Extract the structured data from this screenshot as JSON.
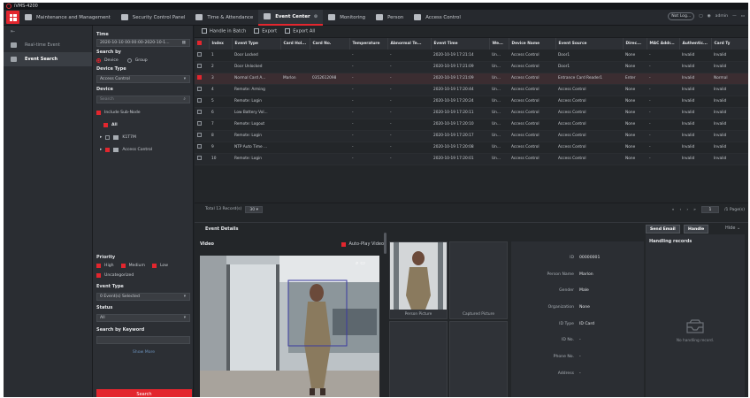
{
  "app": {
    "title": "iVMS-4200"
  },
  "nav": {
    "tabs": [
      {
        "label": "Maintenance and Management"
      },
      {
        "label": "Security Control Panel"
      },
      {
        "label": "Time & Attendance"
      },
      {
        "label": "Event Center"
      },
      {
        "label": "Monitoring"
      },
      {
        "label": "Person"
      },
      {
        "label": "Access Control"
      }
    ],
    "right": {
      "status": "Not Log...",
      "user": "admin"
    }
  },
  "leftnav": {
    "items": [
      {
        "label": "Real-time Event"
      },
      {
        "label": "Event Search"
      }
    ]
  },
  "filters": {
    "time_label": "Time",
    "time_value": "2020-10-10 00:00:00-2020-10-1...",
    "search_by_label": "Search by",
    "search_by_options": [
      "Device",
      "Group"
    ],
    "device_type_label": "Device Type",
    "device_type_value": "Access Control",
    "device_label": "Device",
    "device_search_placeholder": "Search",
    "include_sub_node": "Include Sub-Node",
    "tree_all": "All",
    "tree_node1": "K1T7M",
    "tree_node2": "Access Control",
    "priority_label": "Priority",
    "priority_options": [
      "High",
      "Medium",
      "Low",
      "Uncategorized"
    ],
    "event_type_label": "Event Type",
    "event_type_value": "0 Event(s) Selected",
    "status_label": "Status",
    "status_value": "All",
    "keyword_label": "Search by Keyword",
    "show_more": "Show More",
    "search_button": "Search"
  },
  "toolbar": {
    "handle_batch": "Handle in Batch",
    "export": "Export",
    "export_all": "Export All"
  },
  "table": {
    "headers": [
      "",
      "Index",
      "Event Type",
      "Card Hol...",
      "Card No.",
      "Temperature",
      "Abnormal Te...",
      "Event Time",
      "We...",
      "Device Name",
      "Event Source",
      "Direc...",
      "MAC Addr...",
      "Authentic...",
      "Card Ty"
    ],
    "rows": [
      {
        "idx": "1",
        "type": "Door Locked",
        "holder": "",
        "card": "",
        "temp": "-",
        "abn": "-",
        "time": "2020-10-19 17:21:14",
        "we": "Un...",
        "device": "Access Control",
        "source": "Door1",
        "dir": "None",
        "mac": "-",
        "auth": "Invalid",
        "ct": "Invalid",
        "sel": false
      },
      {
        "idx": "2",
        "type": "Door Unlocked",
        "holder": "",
        "card": "",
        "temp": "-",
        "abn": "-",
        "time": "2020-10-19 17:21:09",
        "we": "Un...",
        "device": "Access Control",
        "source": "Door1",
        "dir": "None",
        "mac": "-",
        "auth": "Invalid",
        "ct": "Invalid",
        "sel": false
      },
      {
        "idx": "3",
        "type": "Normal Card A...",
        "holder": "Marlon",
        "card": "0352612098",
        "temp": "-",
        "abn": "-",
        "time": "2020-10-19 17:21:09",
        "we": "Un...",
        "device": "Access Control",
        "source": "Entrance Card Reader1",
        "dir": "Enter",
        "mac": "-",
        "auth": "Invalid",
        "ct": "Normal",
        "sel": true
      },
      {
        "idx": "4",
        "type": "Remote: Arming",
        "holder": "",
        "card": "",
        "temp": "-",
        "abn": "-",
        "time": "2020-10-19 17:20:44",
        "we": "Un...",
        "device": "Access Control",
        "source": "Access Control",
        "dir": "None",
        "mac": "-",
        "auth": "Invalid",
        "ct": "Invalid",
        "sel": false
      },
      {
        "idx": "5",
        "type": "Remote: Login",
        "holder": "",
        "card": "",
        "temp": "-",
        "abn": "-",
        "time": "2020-10-19 17:20:24",
        "we": "Un...",
        "device": "Access Control",
        "source": "Access Control",
        "dir": "None",
        "mac": "-",
        "auth": "Invalid",
        "ct": "Invalid",
        "sel": false
      },
      {
        "idx": "6",
        "type": "Low Battery Vol...",
        "holder": "",
        "card": "",
        "temp": "-",
        "abn": "-",
        "time": "2020-10-19 17:20:11",
        "we": "Un...",
        "device": "Access Control",
        "source": "Access Control",
        "dir": "None",
        "mac": "-",
        "auth": "Invalid",
        "ct": "Invalid",
        "sel": false
      },
      {
        "idx": "7",
        "type": "Remote: Logout",
        "holder": "",
        "card": "",
        "temp": "-",
        "abn": "-",
        "time": "2020-10-19 17:20:10",
        "we": "Un...",
        "device": "Access Control",
        "source": "Access Control",
        "dir": "None",
        "mac": "-",
        "auth": "Invalid",
        "ct": "Invalid",
        "sel": false
      },
      {
        "idx": "8",
        "type": "Remote: Login",
        "holder": "",
        "card": "",
        "temp": "-",
        "abn": "-",
        "time": "2020-10-19 17:20:17",
        "we": "Un...",
        "device": "Access Control",
        "source": "Access Control",
        "dir": "None",
        "mac": "-",
        "auth": "Invalid",
        "ct": "Invalid",
        "sel": false
      },
      {
        "idx": "9",
        "type": "NTP Auto Time ...",
        "holder": "",
        "card": "",
        "temp": "-",
        "abn": "-",
        "time": "2020-10-19 17:20:08",
        "we": "Un...",
        "device": "Access Control",
        "source": "Access Control",
        "dir": "None",
        "mac": "-",
        "auth": "Invalid",
        "ct": "Invalid",
        "sel": false
      },
      {
        "idx": "10",
        "type": "Remote: Login",
        "holder": "",
        "card": "",
        "temp": "-",
        "abn": "-",
        "time": "2020-10-19 17:20:01",
        "we": "Un...",
        "device": "Access Control",
        "source": "Access Control",
        "dir": "None",
        "mac": "-",
        "auth": "Invalid",
        "ct": "Invalid",
        "sel": false
      }
    ]
  },
  "pager": {
    "total": "Total 13 Record(s)",
    "per_page": "30",
    "page": "1",
    "pages": "/1 Page(s)"
  },
  "details": {
    "title": "Event Details",
    "send_email": "Send Email",
    "handle": "Handle",
    "hide": "Hide",
    "video_label": "Video",
    "auto_play": "Auto-Play Video",
    "person_picture": "Person Picture",
    "captured_picture": "Captured Picture",
    "person": [
      {
        "k": "ID",
        "v": "00000001"
      },
      {
        "k": "Person Name",
        "v": "Marlon"
      },
      {
        "k": "Gender",
        "v": "Male"
      },
      {
        "k": "Organization",
        "v": "None"
      },
      {
        "k": "ID Type",
        "v": "ID Card"
      },
      {
        "k": "ID No.",
        "v": "-"
      },
      {
        "k": "Phone No.",
        "v": "-"
      },
      {
        "k": "Address",
        "v": "-"
      }
    ],
    "handling_title": "Handling records",
    "no_records": "No handling record."
  },
  "colors": {
    "accent": "#e3262e",
    "bg": "#1f2227"
  }
}
